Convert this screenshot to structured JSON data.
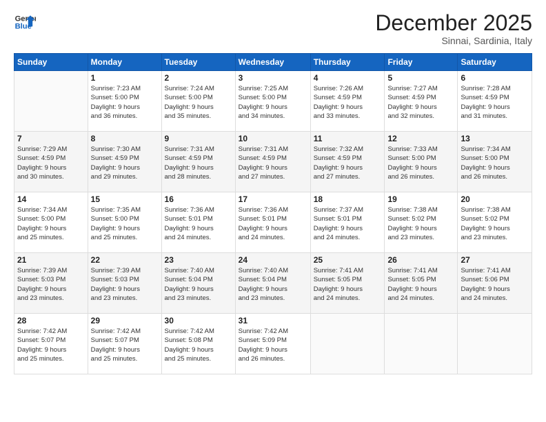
{
  "logo": {
    "line1": "General",
    "line2": "Blue"
  },
  "title": "December 2025",
  "location": "Sinnai, Sardinia, Italy",
  "days_of_week": [
    "Sunday",
    "Monday",
    "Tuesday",
    "Wednesday",
    "Thursday",
    "Friday",
    "Saturday"
  ],
  "weeks": [
    [
      {
        "day": "",
        "info": ""
      },
      {
        "day": "1",
        "info": "Sunrise: 7:23 AM\nSunset: 5:00 PM\nDaylight: 9 hours\nand 36 minutes."
      },
      {
        "day": "2",
        "info": "Sunrise: 7:24 AM\nSunset: 5:00 PM\nDaylight: 9 hours\nand 35 minutes."
      },
      {
        "day": "3",
        "info": "Sunrise: 7:25 AM\nSunset: 5:00 PM\nDaylight: 9 hours\nand 34 minutes."
      },
      {
        "day": "4",
        "info": "Sunrise: 7:26 AM\nSunset: 4:59 PM\nDaylight: 9 hours\nand 33 minutes."
      },
      {
        "day": "5",
        "info": "Sunrise: 7:27 AM\nSunset: 4:59 PM\nDaylight: 9 hours\nand 32 minutes."
      },
      {
        "day": "6",
        "info": "Sunrise: 7:28 AM\nSunset: 4:59 PM\nDaylight: 9 hours\nand 31 minutes."
      }
    ],
    [
      {
        "day": "7",
        "info": "Sunrise: 7:29 AM\nSunset: 4:59 PM\nDaylight: 9 hours\nand 30 minutes."
      },
      {
        "day": "8",
        "info": "Sunrise: 7:30 AM\nSunset: 4:59 PM\nDaylight: 9 hours\nand 29 minutes."
      },
      {
        "day": "9",
        "info": "Sunrise: 7:31 AM\nSunset: 4:59 PM\nDaylight: 9 hours\nand 28 minutes."
      },
      {
        "day": "10",
        "info": "Sunrise: 7:31 AM\nSunset: 4:59 PM\nDaylight: 9 hours\nand 27 minutes."
      },
      {
        "day": "11",
        "info": "Sunrise: 7:32 AM\nSunset: 4:59 PM\nDaylight: 9 hours\nand 27 minutes."
      },
      {
        "day": "12",
        "info": "Sunrise: 7:33 AM\nSunset: 5:00 PM\nDaylight: 9 hours\nand 26 minutes."
      },
      {
        "day": "13",
        "info": "Sunrise: 7:34 AM\nSunset: 5:00 PM\nDaylight: 9 hours\nand 26 minutes."
      }
    ],
    [
      {
        "day": "14",
        "info": "Sunrise: 7:34 AM\nSunset: 5:00 PM\nDaylight: 9 hours\nand 25 minutes."
      },
      {
        "day": "15",
        "info": "Sunrise: 7:35 AM\nSunset: 5:00 PM\nDaylight: 9 hours\nand 25 minutes."
      },
      {
        "day": "16",
        "info": "Sunrise: 7:36 AM\nSunset: 5:01 PM\nDaylight: 9 hours\nand 24 minutes."
      },
      {
        "day": "17",
        "info": "Sunrise: 7:36 AM\nSunset: 5:01 PM\nDaylight: 9 hours\nand 24 minutes."
      },
      {
        "day": "18",
        "info": "Sunrise: 7:37 AM\nSunset: 5:01 PM\nDaylight: 9 hours\nand 24 minutes."
      },
      {
        "day": "19",
        "info": "Sunrise: 7:38 AM\nSunset: 5:02 PM\nDaylight: 9 hours\nand 23 minutes."
      },
      {
        "day": "20",
        "info": "Sunrise: 7:38 AM\nSunset: 5:02 PM\nDaylight: 9 hours\nand 23 minutes."
      }
    ],
    [
      {
        "day": "21",
        "info": "Sunrise: 7:39 AM\nSunset: 5:03 PM\nDaylight: 9 hours\nand 23 minutes."
      },
      {
        "day": "22",
        "info": "Sunrise: 7:39 AM\nSunset: 5:03 PM\nDaylight: 9 hours\nand 23 minutes."
      },
      {
        "day": "23",
        "info": "Sunrise: 7:40 AM\nSunset: 5:04 PM\nDaylight: 9 hours\nand 23 minutes."
      },
      {
        "day": "24",
        "info": "Sunrise: 7:40 AM\nSunset: 5:04 PM\nDaylight: 9 hours\nand 23 minutes."
      },
      {
        "day": "25",
        "info": "Sunrise: 7:41 AM\nSunset: 5:05 PM\nDaylight: 9 hours\nand 24 minutes."
      },
      {
        "day": "26",
        "info": "Sunrise: 7:41 AM\nSunset: 5:05 PM\nDaylight: 9 hours\nand 24 minutes."
      },
      {
        "day": "27",
        "info": "Sunrise: 7:41 AM\nSunset: 5:06 PM\nDaylight: 9 hours\nand 24 minutes."
      }
    ],
    [
      {
        "day": "28",
        "info": "Sunrise: 7:42 AM\nSunset: 5:07 PM\nDaylight: 9 hours\nand 25 minutes."
      },
      {
        "day": "29",
        "info": "Sunrise: 7:42 AM\nSunset: 5:07 PM\nDaylight: 9 hours\nand 25 minutes."
      },
      {
        "day": "30",
        "info": "Sunrise: 7:42 AM\nSunset: 5:08 PM\nDaylight: 9 hours\nand 25 minutes."
      },
      {
        "day": "31",
        "info": "Sunrise: 7:42 AM\nSunset: 5:09 PM\nDaylight: 9 hours\nand 26 minutes."
      },
      {
        "day": "",
        "info": ""
      },
      {
        "day": "",
        "info": ""
      },
      {
        "day": "",
        "info": ""
      }
    ]
  ]
}
